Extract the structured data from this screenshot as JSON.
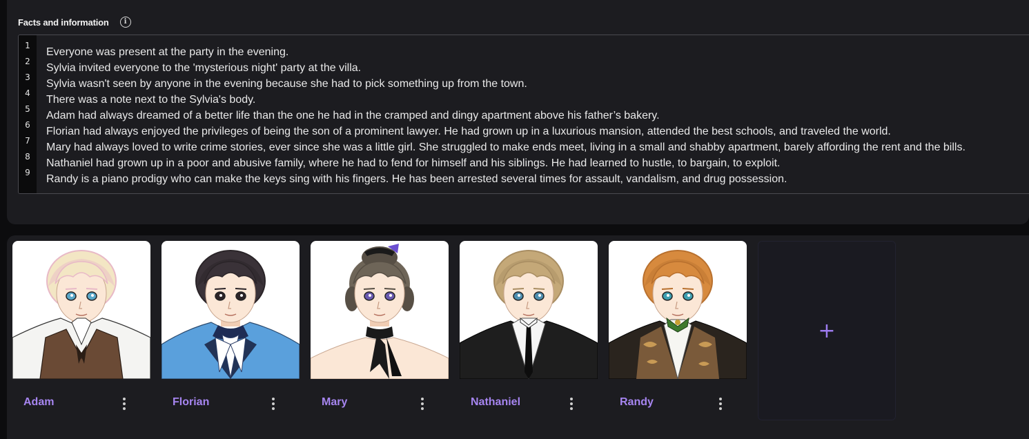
{
  "facts": {
    "title": "Facts and information",
    "info_icon": "info-icon",
    "lines": [
      "Everyone was present at the party in the evening.",
      "Sylvia invited everyone to the 'mysterious night' party at the villa.",
      "Sylvia wasn't seen by anyone in the evening because she had to pick something up from the town.",
      "There was a note next to the Sylvia's body.",
      "Adam had always dreamed of a better life than the one he had in the cramped and dingy apartment above his father’s bakery.",
      "Florian had always enjoyed the privileges of being the son of a prominent lawyer. He had grown up in a luxurious mansion, attended the best schools, and traveled the world.",
      "Mary had always loved to write crime stories, ever since she was a little girl. She struggled to make ends meet, living in a small and shabby apartment, barely affording the rent and the bills.",
      "Nathaniel had grown up in a poor and abusive family, where he had to fend for himself and his siblings. He had learned to hustle, to bargain, to exploit.",
      "Randy is a piano prodigy who can make the keys sing with his fingers. He has been arrested several times for assault, vandalism, and drug possession."
    ],
    "line_numbers": [
      "1",
      "2",
      "3",
      "4",
      "5",
      "6",
      "7",
      "8",
      "9"
    ]
  },
  "characters": [
    {
      "name": "Adam",
      "hair": "#f3e6c4",
      "hair_shade": "#e8b9c7",
      "eyes": "#5aa7c8",
      "outfit": "vest"
    },
    {
      "name": "Florian",
      "hair": "#3a3238",
      "hair_shade": "#2a2428",
      "eyes": "#2b2428",
      "outfit": "blue"
    },
    {
      "name": "Mary",
      "hair": "#6e6558",
      "hair_shade": "#574f45",
      "eyes": "#6a5ab0",
      "outfit": "dress"
    },
    {
      "name": "Nathaniel",
      "hair": "#c4a878",
      "hair_shade": "#a88d62",
      "eyes": "#4f8fb0",
      "outfit": "tux"
    },
    {
      "name": "Randy",
      "hair": "#d78a3e",
      "hair_shade": "#b8702e",
      "eyes": "#3e9fb0",
      "outfit": "paisley"
    }
  ],
  "add_button": {
    "label": "+",
    "icon": "plus-icon"
  },
  "colors": {
    "accent": "#a685f0",
    "panel": "#1c1c20",
    "background": "#0c0c0e"
  }
}
